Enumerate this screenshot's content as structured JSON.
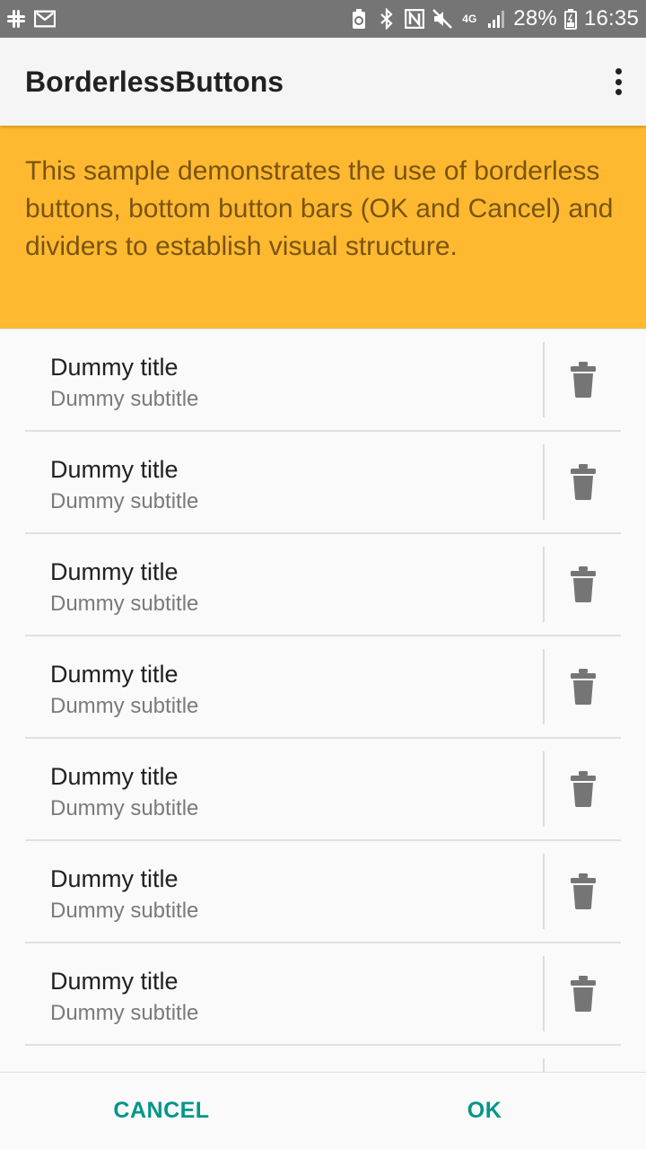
{
  "status_bar": {
    "battery_percent": "28%",
    "time": "16:35",
    "left_icons": [
      "slack-icon",
      "gmail-icon"
    ],
    "right_icons": [
      "battery-saver-icon",
      "bluetooth-icon",
      "nfc-icon",
      "mute-icon",
      "4g-lte-icon",
      "signal-icon",
      "battery-charging-icon"
    ],
    "network_label": "4G"
  },
  "app_bar": {
    "title": "BorderlessButtons",
    "menu_icon": "overflow-menu-icon"
  },
  "intro": {
    "text": "This sample demonstrates the use of borderless buttons, bottom button bars (OK and Cancel) and dividers to establish visual structure.",
    "background": "#ffb930"
  },
  "list": {
    "items": [
      {
        "title": "Dummy title",
        "subtitle": "Dummy subtitle",
        "action_icon": "trash-icon"
      },
      {
        "title": "Dummy title",
        "subtitle": "Dummy subtitle",
        "action_icon": "trash-icon"
      },
      {
        "title": "Dummy title",
        "subtitle": "Dummy subtitle",
        "action_icon": "trash-icon"
      },
      {
        "title": "Dummy title",
        "subtitle": "Dummy subtitle",
        "action_icon": "trash-icon"
      },
      {
        "title": "Dummy title",
        "subtitle": "Dummy subtitle",
        "action_icon": "trash-icon"
      },
      {
        "title": "Dummy title",
        "subtitle": "Dummy subtitle",
        "action_icon": "trash-icon"
      },
      {
        "title": "Dummy title",
        "subtitle": "Dummy subtitle",
        "action_icon": "trash-icon"
      }
    ]
  },
  "button_bar": {
    "cancel_label": "CANCEL",
    "ok_label": "OK",
    "accent_color": "#009688"
  }
}
